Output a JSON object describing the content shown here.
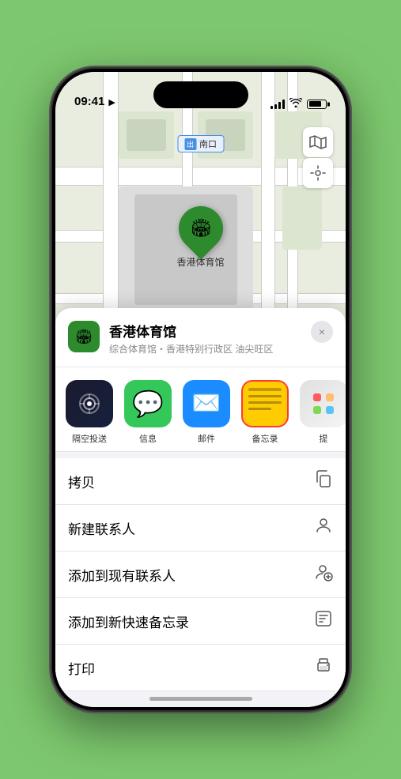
{
  "status_bar": {
    "time": "09:41",
    "location_arrow": "▶"
  },
  "map": {
    "label_prefix": "南口",
    "stadium_name": "香港体育馆",
    "stadium_pin_emoji": "🏟"
  },
  "location_card": {
    "name": "香港体育馆",
    "subtitle": "综合体育馆・香港特别行政区 油尖旺区",
    "close_label": "×"
  },
  "share_items": [
    {
      "id": "airdrop",
      "label": "隔空投送"
    },
    {
      "id": "messages",
      "label": "信息"
    },
    {
      "id": "mail",
      "label": "邮件"
    },
    {
      "id": "notes",
      "label": "备忘录"
    },
    {
      "id": "more",
      "label": "提"
    }
  ],
  "actions": [
    {
      "id": "copy",
      "label": "拷贝",
      "icon": "⎘"
    },
    {
      "id": "new-contact",
      "label": "新建联系人",
      "icon": "👤"
    },
    {
      "id": "add-contact",
      "label": "添加到现有联系人",
      "icon": "👤"
    },
    {
      "id": "quick-note",
      "label": "添加到新快速备忘录",
      "icon": "⊡"
    },
    {
      "id": "print",
      "label": "打印",
      "icon": "🖨"
    }
  ]
}
